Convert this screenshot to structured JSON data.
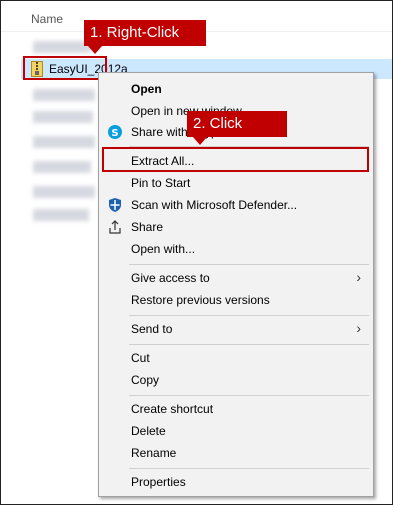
{
  "explorer": {
    "column_header": "Name",
    "selected_file": "EasyUI_2012a"
  },
  "callouts": {
    "step1": "1. Right-Click",
    "step2": "2. Click"
  },
  "menu": {
    "items": [
      {
        "label": "Open",
        "bold": true
      },
      {
        "label": "Open in new window"
      },
      {
        "label": "Share with Skype",
        "icon": "skype-icon"
      },
      {
        "label": "Extract All..."
      },
      {
        "label": "Pin to Start"
      },
      {
        "label": "Scan with Microsoft Defender...",
        "icon": "defender-shield-icon"
      },
      {
        "label": "Share",
        "icon": "share-icon"
      },
      {
        "label": "Open with..."
      },
      {
        "label": "Give access to",
        "submenu": true
      },
      {
        "label": "Restore previous versions"
      },
      {
        "label": "Send to",
        "submenu": true
      },
      {
        "label": "Cut"
      },
      {
        "label": "Copy"
      },
      {
        "label": "Create shortcut"
      },
      {
        "label": "Delete"
      },
      {
        "label": "Rename"
      },
      {
        "label": "Properties"
      }
    ],
    "submenu_arrow": "›"
  },
  "colors": {
    "highlight": "#c00000",
    "selection": "#cce8ff",
    "menu_bg": "#f2f2f2"
  }
}
